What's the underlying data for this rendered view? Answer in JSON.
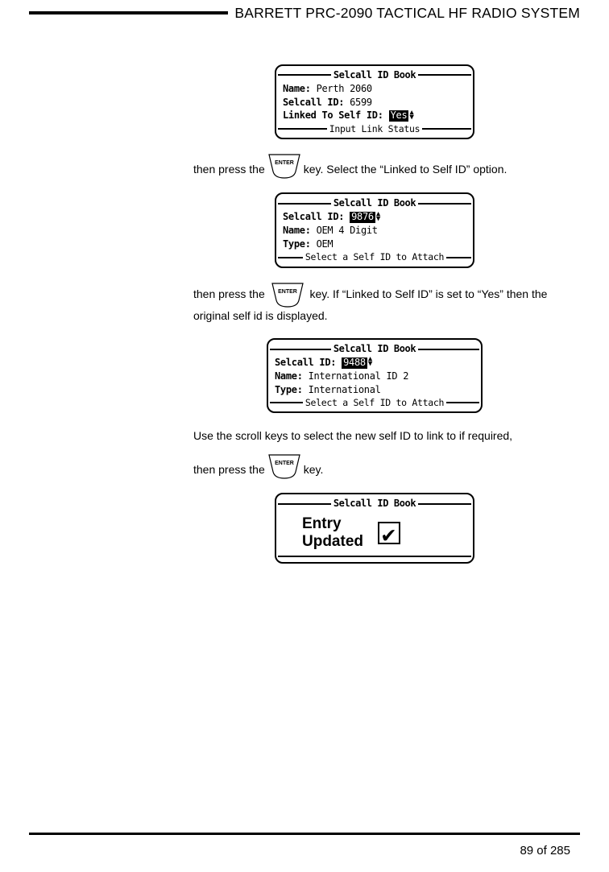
{
  "header": {
    "title": "BARRETT PRC-2090 TACTICAL HF RADIO SYSTEM"
  },
  "screens": {
    "s1": {
      "title": "Selcall ID Book",
      "row1_label": "Name:",
      "row1_value": "Perth 2060",
      "row2_label": "Selcall ID:",
      "row2_value": "6599",
      "row3_label": "Linked To Self ID:",
      "row3_value": "Yes",
      "footer": "Input Link Status"
    },
    "s2": {
      "title": "Selcall ID Book",
      "row1_label": "Selcall ID:",
      "row1_value": "9876",
      "row2_label": "Name:",
      "row2_value": "OEM 4 Digit",
      "row3_label": "Type:",
      "row3_value": "OEM",
      "footer": "Select a Self ID to Attach"
    },
    "s3": {
      "title": "Selcall ID Book",
      "row1_label": "Selcall ID:",
      "row1_value": "9488",
      "row2_label": "Name:",
      "row2_value": "International ID 2",
      "row3_label": "Type:",
      "row3_value": "International",
      "footer": "Select a Self ID to Attach"
    },
    "s4": {
      "title": "Selcall ID Book",
      "line1": "Entry",
      "line2": "Updated"
    }
  },
  "body": {
    "p1a": "then press  the ",
    "p1b": " key. Select the “Linked to Self ID” option.",
    "p2a": "then press  the ",
    "p2b": " key. If “Linked to Self ID” is set to “Yes” then the original self id is displayed.",
    "p3": "Use the scroll keys to select the new self ID to link to if required,",
    "p4a": "then press  the ",
    "p4b": " key."
  },
  "key": {
    "enter_label": "ENTER"
  },
  "footer": {
    "page": "89 of 285"
  }
}
